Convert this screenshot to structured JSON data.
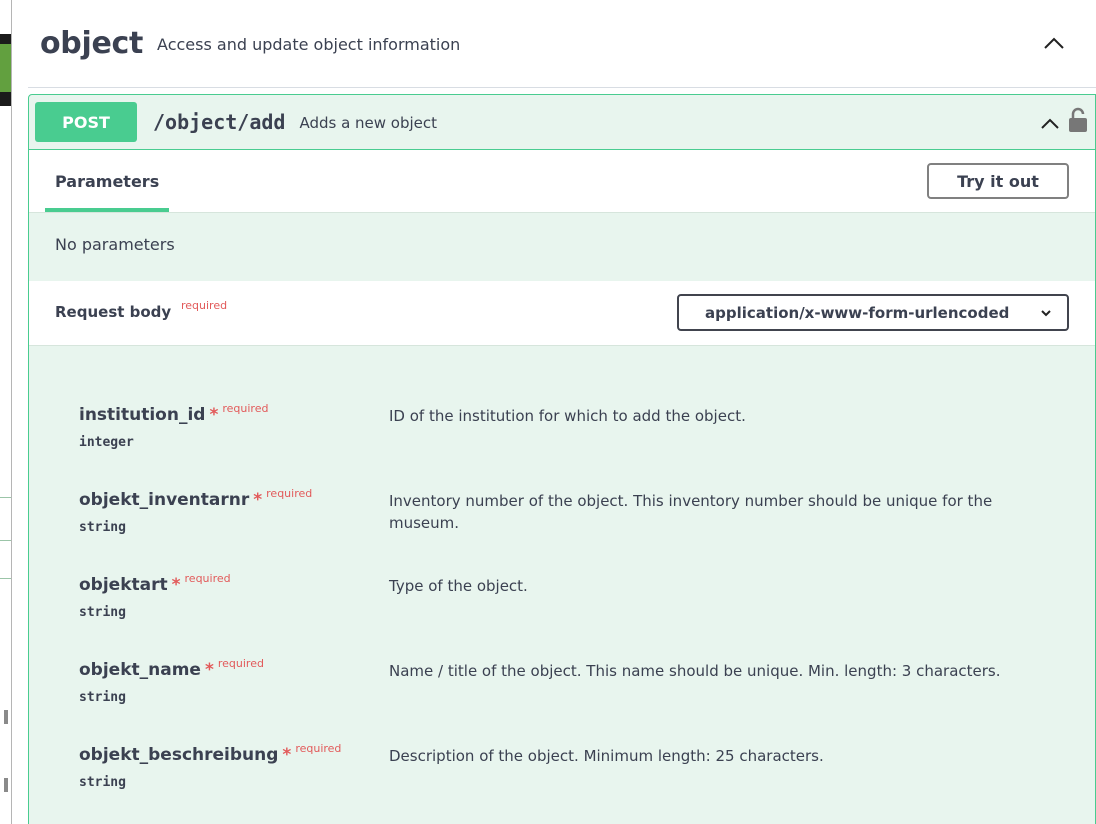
{
  "tag": {
    "name": "object",
    "description": "Access and update object information"
  },
  "operation": {
    "method": "POST",
    "path": "/object/add",
    "summary": "Adds a new object"
  },
  "parameters": {
    "tab_label": "Parameters",
    "try_button": "Try it out",
    "empty_text": "No parameters"
  },
  "request_body": {
    "title": "Request body",
    "required_label": "required",
    "content_type": "application/x-www-form-urlencoded"
  },
  "fields": [
    {
      "name": "institution_id",
      "star": "*",
      "required": "required",
      "type": "integer",
      "description": "ID of the institution for which to add the object."
    },
    {
      "name": "objekt_inventarnr",
      "star": "*",
      "required": "required",
      "type": "string",
      "description": "Inventory number of the object. This inventory number should be unique for the museum."
    },
    {
      "name": "objektart",
      "star": "*",
      "required": "required",
      "type": "string",
      "description": "Type of the object."
    },
    {
      "name": "objekt_name",
      "star": "*",
      "required": "required",
      "type": "string",
      "description": "Name / title of the object. This name should be unique. Min. length: 3 characters."
    },
    {
      "name": "objekt_beschreibung",
      "star": "*",
      "required": "required",
      "type": "string",
      "description": "Description of the object. Minimum length: 25 characters."
    }
  ],
  "colors": {
    "post_green": "#49cc90",
    "block_bg": "#e8f5ee",
    "required_red": "#e25a5a",
    "text": "#3b4151"
  }
}
